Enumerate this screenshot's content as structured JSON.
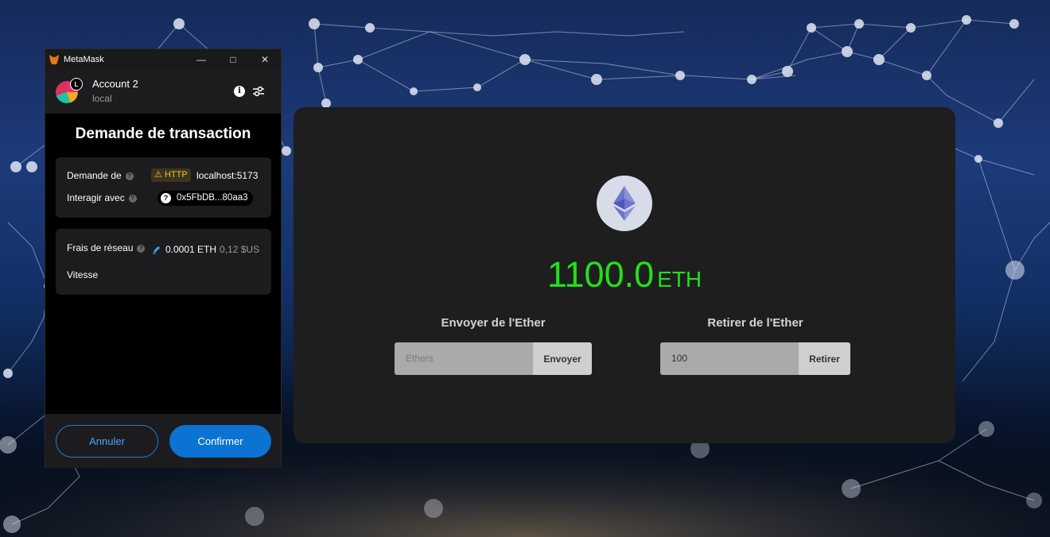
{
  "metamask": {
    "window_title": "MetaMask",
    "account_name": "Account 2",
    "network": "local",
    "account_badge": "L",
    "page_title": "Demande de transaction",
    "request_from_label": "Demande de",
    "http_label": "HTTP",
    "origin": "localhost:5173",
    "interact_label": "Interagir avec",
    "contract_address": "0x5FbDB...80aa3",
    "network_fee_label": "Frais de réseau",
    "fee_eth": "0.0001 ETH",
    "fee_usd": "0,12 $US",
    "speed_label": "Vitesse",
    "cancel_label": "Annuler",
    "confirm_label": "Confirmer",
    "icons": [
      "metamask-fox-icon",
      "minimize-icon",
      "maximize-icon",
      "close-icon",
      "info-icon",
      "sliders-icon",
      "help-icon",
      "warning-icon",
      "pencil-icon"
    ]
  },
  "dapp": {
    "balance_value": "1100.0",
    "balance_unit": "ETH",
    "send": {
      "title": "Envoyer de l'Ether",
      "placeholder": "Ethers",
      "button_label": "Envoyer"
    },
    "withdraw": {
      "title": "Retirer de l'Ether",
      "value": "100",
      "button_label": "Retirer"
    },
    "colors": {
      "balance": "#22e01a",
      "panel": "#1e1e1e",
      "confirm": "#0b73d1"
    }
  }
}
